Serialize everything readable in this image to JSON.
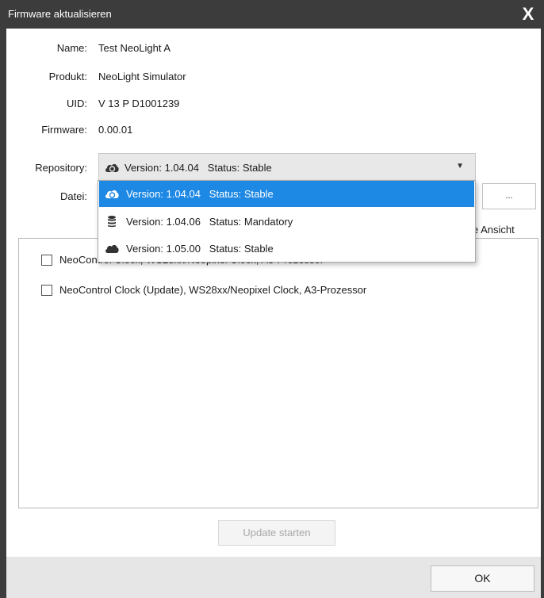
{
  "window": {
    "title": "Firmware aktualisieren",
    "close_glyph": "X"
  },
  "info": {
    "name_label": "Name:",
    "name_value": "Test NeoLight A",
    "product_label": "Produkt:",
    "product_value": "NeoLight Simulator",
    "uid_label": "UID:",
    "uid_value": "V 13 P D1001239",
    "firmware_label": "Firmware:",
    "firmware_value": "0.00.01"
  },
  "repository": {
    "label": "Repository:",
    "selected_text": "Version: 1.04.04   Status: Stable",
    "selected_icon": "cloud-sync-icon",
    "arrow_glyph": "▼",
    "options": [
      {
        "text": "Version: 1.04.04   Status: Stable",
        "icon": "cloud-sync-icon",
        "selected": true
      },
      {
        "text": "Version: 1.04.06   Status: Mandatory",
        "icon": "database-icon",
        "selected": false
      },
      {
        "text": "Version: 1.05.00   Status: Stable",
        "icon": "cloud-icon",
        "selected": false
      }
    ]
  },
  "file": {
    "label": "Datei:",
    "browse_label": "..."
  },
  "view_label_partial": "e Ansicht",
  "list": {
    "items": [
      {
        "label": "NeoControl Clock, WS28xx/Neopixel Clock, A3-Prozessor",
        "checked": false
      },
      {
        "label": "NeoControl Clock (Update), WS28xx/Neopixel Clock, A3-Prozessor",
        "checked": false
      }
    ]
  },
  "buttons": {
    "update_label": "Update starten",
    "ok_label": "OK"
  },
  "colors": {
    "titlebar": "#3c3c3c",
    "selection": "#1e88e5",
    "footer": "#e6e6e6"
  }
}
